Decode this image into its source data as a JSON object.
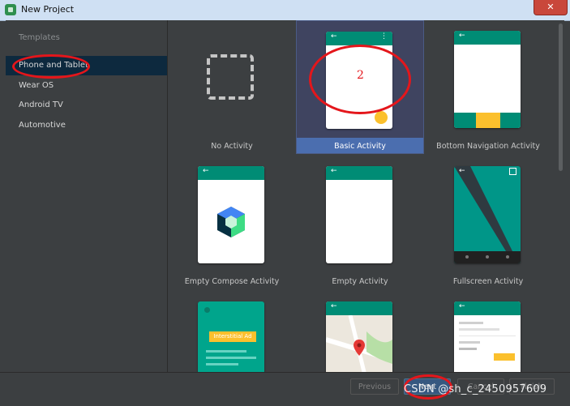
{
  "window": {
    "title": "New Project",
    "close_symbol": "✕"
  },
  "sidebar": {
    "heading": "Templates",
    "items": [
      {
        "label": "Phone and Tablet",
        "selected": true
      },
      {
        "label": "Wear OS"
      },
      {
        "label": "Android TV"
      },
      {
        "label": "Automotive"
      }
    ]
  },
  "templates": [
    {
      "label": "No Activity"
    },
    {
      "label": "Basic Activity",
      "selected": true
    },
    {
      "label": "Bottom Navigation Activity"
    },
    {
      "label": "Empty Compose Activity"
    },
    {
      "label": "Empty Activity"
    },
    {
      "label": "Fullscreen Activity"
    },
    {
      "label": "Interstitial Ad"
    },
    {
      "label": ""
    },
    {
      "label": ""
    }
  ],
  "preview_text": {
    "interstitial_ad": "Interstitial Ad"
  },
  "buttons": {
    "previous": "Previous",
    "next": "Next",
    "cancel": "Cancel",
    "finish": "Finish"
  },
  "annotations": {
    "step_number": "2"
  },
  "watermark": "CSDN @sh_c_2450957609",
  "colors": {
    "accent_teal": "#008c75",
    "fab_yellow": "#fbc02d",
    "selection_blue": "#4b6eaf",
    "annotation_red": "#e4161b"
  }
}
